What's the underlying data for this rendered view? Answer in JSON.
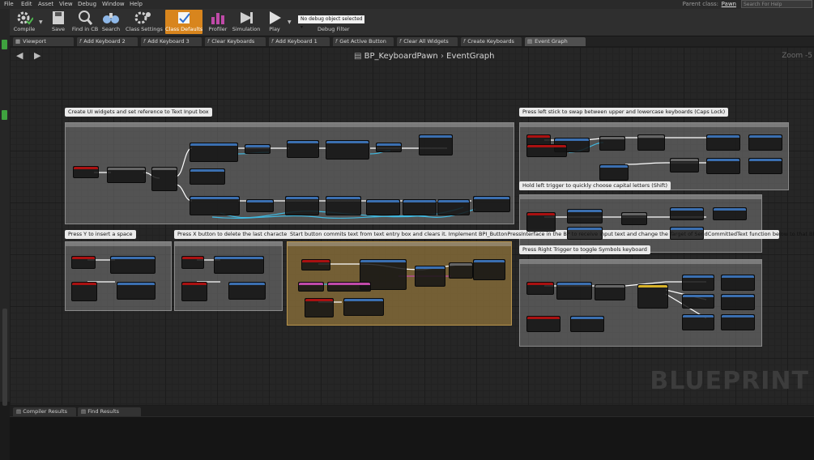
{
  "menu": [
    "File",
    "Edit",
    "Asset",
    "View",
    "Debug",
    "Window",
    "Help"
  ],
  "parent_class": {
    "label": "Parent class:",
    "value": "Pawn"
  },
  "help_search_placeholder": "Search For Help",
  "toolbar": {
    "compile": "Compile",
    "save": "Save",
    "find_in_cb": "Find in CB",
    "search": "Search",
    "class_settings": "Class Settings",
    "class_defaults": "Class Defaults",
    "profiler": "Profiler",
    "simulation": "Simulation",
    "play": "Play",
    "debug_object": "No debug object selected",
    "debug_filter": "Debug Filter"
  },
  "tabs": [
    "Viewport",
    "Add Keyboard 2",
    "Add Keyboard 3",
    "Clear Keyboards",
    "Add Keyboard 1",
    "Get Active Button",
    "Clear All Widgets",
    "Create Keyboards",
    "Event Graph"
  ],
  "breadcrumb": {
    "blueprint": "BP_KeyboardPawn",
    "graph": "EventGraph"
  },
  "zoom": "Zoom -5",
  "watermark": "BLUEPRINT",
  "comments": {
    "create_ui": "Create UI widgets and set reference to Text Input box",
    "left_stick": "Press left stick to swap between upper and lowercase keyboards (Caps Lock)",
    "left_trigger": "Hold left trigger to quickly choose capital letters (Shift)",
    "right_trigger": "Press Right Trigger to toggle Symbols keyboard",
    "press_y": "Press Y to insert a space",
    "press_x": "Press X button to delete the last character",
    "start_button": "Start button commits text from text entry box and clears it. Implement BPI_ButtonPressInterface in the BP to receive input text and change the Target of SendCommittedText function below to that BP."
  },
  "bottom_tabs": [
    "Compiler Results",
    "Find Results"
  ],
  "colors": {
    "accent": "#d8851d",
    "comment_gold": "#96783c",
    "wire_exec": "#ffffff",
    "wire_data": "#3fb8e0"
  }
}
